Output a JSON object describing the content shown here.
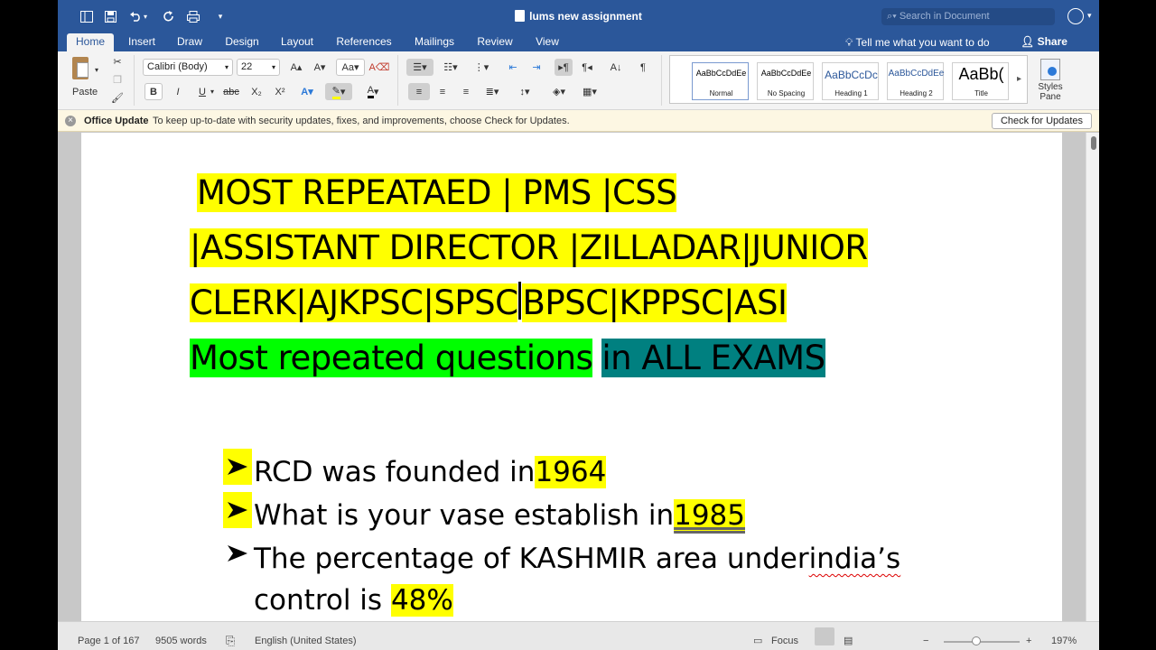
{
  "titlebar": {
    "document_title": "lums new assignment",
    "search_placeholder": "Search in Document"
  },
  "tabs": [
    {
      "label": "Home"
    },
    {
      "label": "Insert"
    },
    {
      "label": "Draw"
    },
    {
      "label": "Design"
    },
    {
      "label": "Layout"
    },
    {
      "label": "References"
    },
    {
      "label": "Mailings"
    },
    {
      "label": "Review"
    },
    {
      "label": "View"
    }
  ],
  "tell_me": "Tell me what you want to do",
  "share_label": "Share",
  "ribbon": {
    "paste_label": "Paste",
    "font_name": "Calibri (Body)",
    "font_size": "22",
    "styles": [
      {
        "sample": "AaBbCcDdEe",
        "name": "Normal"
      },
      {
        "sample": "AaBbCcDdEe",
        "name": "No Spacing"
      },
      {
        "sample": "AaBbCcDc",
        "name": "Heading 1"
      },
      {
        "sample": "AaBbCcDdEe",
        "name": "Heading 2"
      },
      {
        "sample": "AaBb(",
        "name": "Title"
      }
    ],
    "styles_pane_label": "Styles Pane"
  },
  "update_bar": {
    "title": "Office Update",
    "message": "To keep up-to-date with security updates, fixes, and improvements, choose Check for Updates.",
    "button": "Check for Updates"
  },
  "document": {
    "heading_lines": [
      " MOST REPEATAED |  PMS |CSS",
      "|ASSISTANT DIRECTOR |ZILLADAR|JUNIOR",
      "CLERK|AJKPSC|SPSC",
      "BPSC|KPPSC|ASI"
    ],
    "subheading_green": "Most repeated questions",
    "subheading_teal": "in ALL EXAMS",
    "bullets": [
      {
        "text": "RCD was founded in ",
        "highlight": "1964"
      },
      {
        "text": "What is your vase establish in ",
        "highlight": "1985"
      },
      {
        "text_a": "The percentage of KASHMIR area under ",
        "text_b": "india’s"
      }
    ],
    "bullet_continuation": "control is ",
    "bullet_continuation_highlight": "48%"
  },
  "statusbar": {
    "page": "Page 1 of 167",
    "words": "9505 words",
    "language": "English (United States)",
    "focus": "Focus",
    "zoom": "197%"
  },
  "colors": {
    "accent": "#2b579a",
    "highlight_yellow": "#ffff00",
    "highlight_green": "#00ff00",
    "highlight_teal": "#008080"
  }
}
